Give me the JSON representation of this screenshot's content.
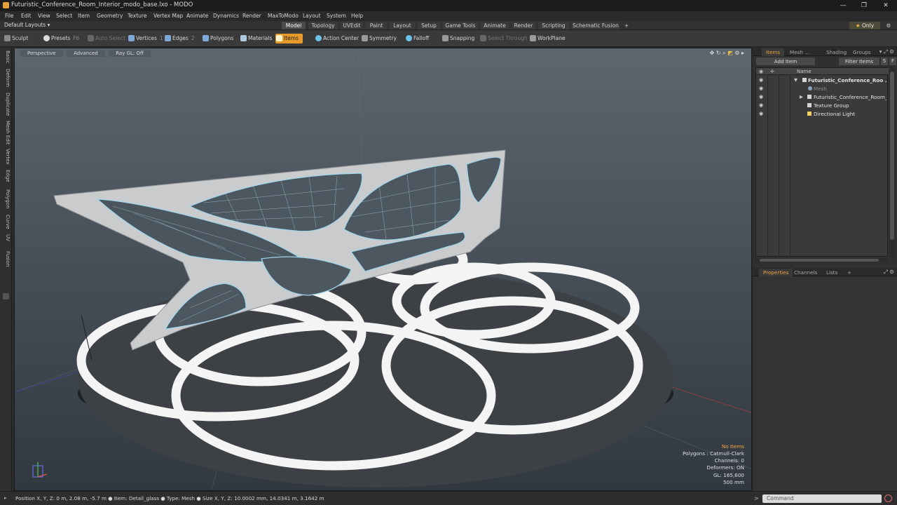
{
  "window": {
    "title": "Futuristic_Conference_Room_Interior_modo_base.lxo - MODO",
    "minimize": "—",
    "maximize": "❐",
    "close": "✕"
  },
  "menu": [
    "File",
    "Edit",
    "View",
    "Select",
    "Item",
    "Geometry",
    "Texture",
    "Vertex Map",
    "Animate",
    "Dynamics",
    "Render",
    "MaxToModo",
    "Layout",
    "System",
    "Help"
  ],
  "layoutbar": {
    "layout_dropdown": "Default Layouts ▾",
    "tabs": [
      "Model",
      "Topology",
      "UVEdit",
      "Paint",
      "Layout",
      "Setup",
      "Game Tools",
      "Animate",
      "Render",
      "Scripting",
      "Schematic Fusion"
    ],
    "active_tab": "Model",
    "add": "+",
    "only": "Only",
    "gear": "⚙"
  },
  "toolbar": {
    "sculpt": "Sculpt",
    "presets": "Presets",
    "presets_key": "F6",
    "auto_select": "Auto Select",
    "vertices": "Vertices",
    "vertices_key": "1",
    "edges": "Edges",
    "edges_key": "2",
    "polygons": "Polygons",
    "materials": "Materials",
    "items": "Items",
    "action_center": "Action Center",
    "symmetry": "Symmetry",
    "falloff": "Falloff",
    "snapping": "Snapping",
    "select_through": "Select Through",
    "workplane": "WorkPlane"
  },
  "left_tabs": [
    "Basic",
    "Deform",
    "Duplicate",
    "Mesh Edit",
    "Vertex",
    "Edge",
    "Polygon",
    "Curve",
    "UV",
    "Fusion"
  ],
  "viewport": {
    "view_mode": "Perspective",
    "shading": "Advanced",
    "render_mode": "Ray GL: Off",
    "info": {
      "selection": "No Items",
      "polygons": "Polygons : Catmull-Clark",
      "channels": "Channels: 0",
      "deformers": "Deformers: ON",
      "gl": "GL: 165,600",
      "scale": "500 mm"
    }
  },
  "status": {
    "text": "Position X, Y, Z:   0 m, 2.08 m, -5.7 m ● Item:  Detail_glass ● Type:  Mesh ● Size X, Y, Z:   10.0002 mm, 14.0341 m, 3.1642 m",
    "command_placeholder": "Command"
  },
  "items_panel": {
    "tabs": [
      "Items",
      "Mesh ...",
      "Shading",
      "Groups"
    ],
    "active_tab": "Items",
    "add_item": "Add Item",
    "filter_items": "Filter Items",
    "s_button": "S",
    "f_button": "F",
    "name_header": "Name",
    "rows": [
      {
        "label": "Futuristic_Conference_Roo ...",
        "style": "bold"
      },
      {
        "label": "Mesh",
        "style": "grey"
      },
      {
        "label": "Futuristic_Conference_Room_...",
        "style": "normal"
      },
      {
        "label": "Texture Group",
        "style": "normal"
      },
      {
        "label": "Directional Light",
        "style": "normal"
      }
    ]
  },
  "properties_panel": {
    "tabs": [
      "Properties",
      "Channels",
      "Lists"
    ],
    "active_tab": "Properties"
  }
}
